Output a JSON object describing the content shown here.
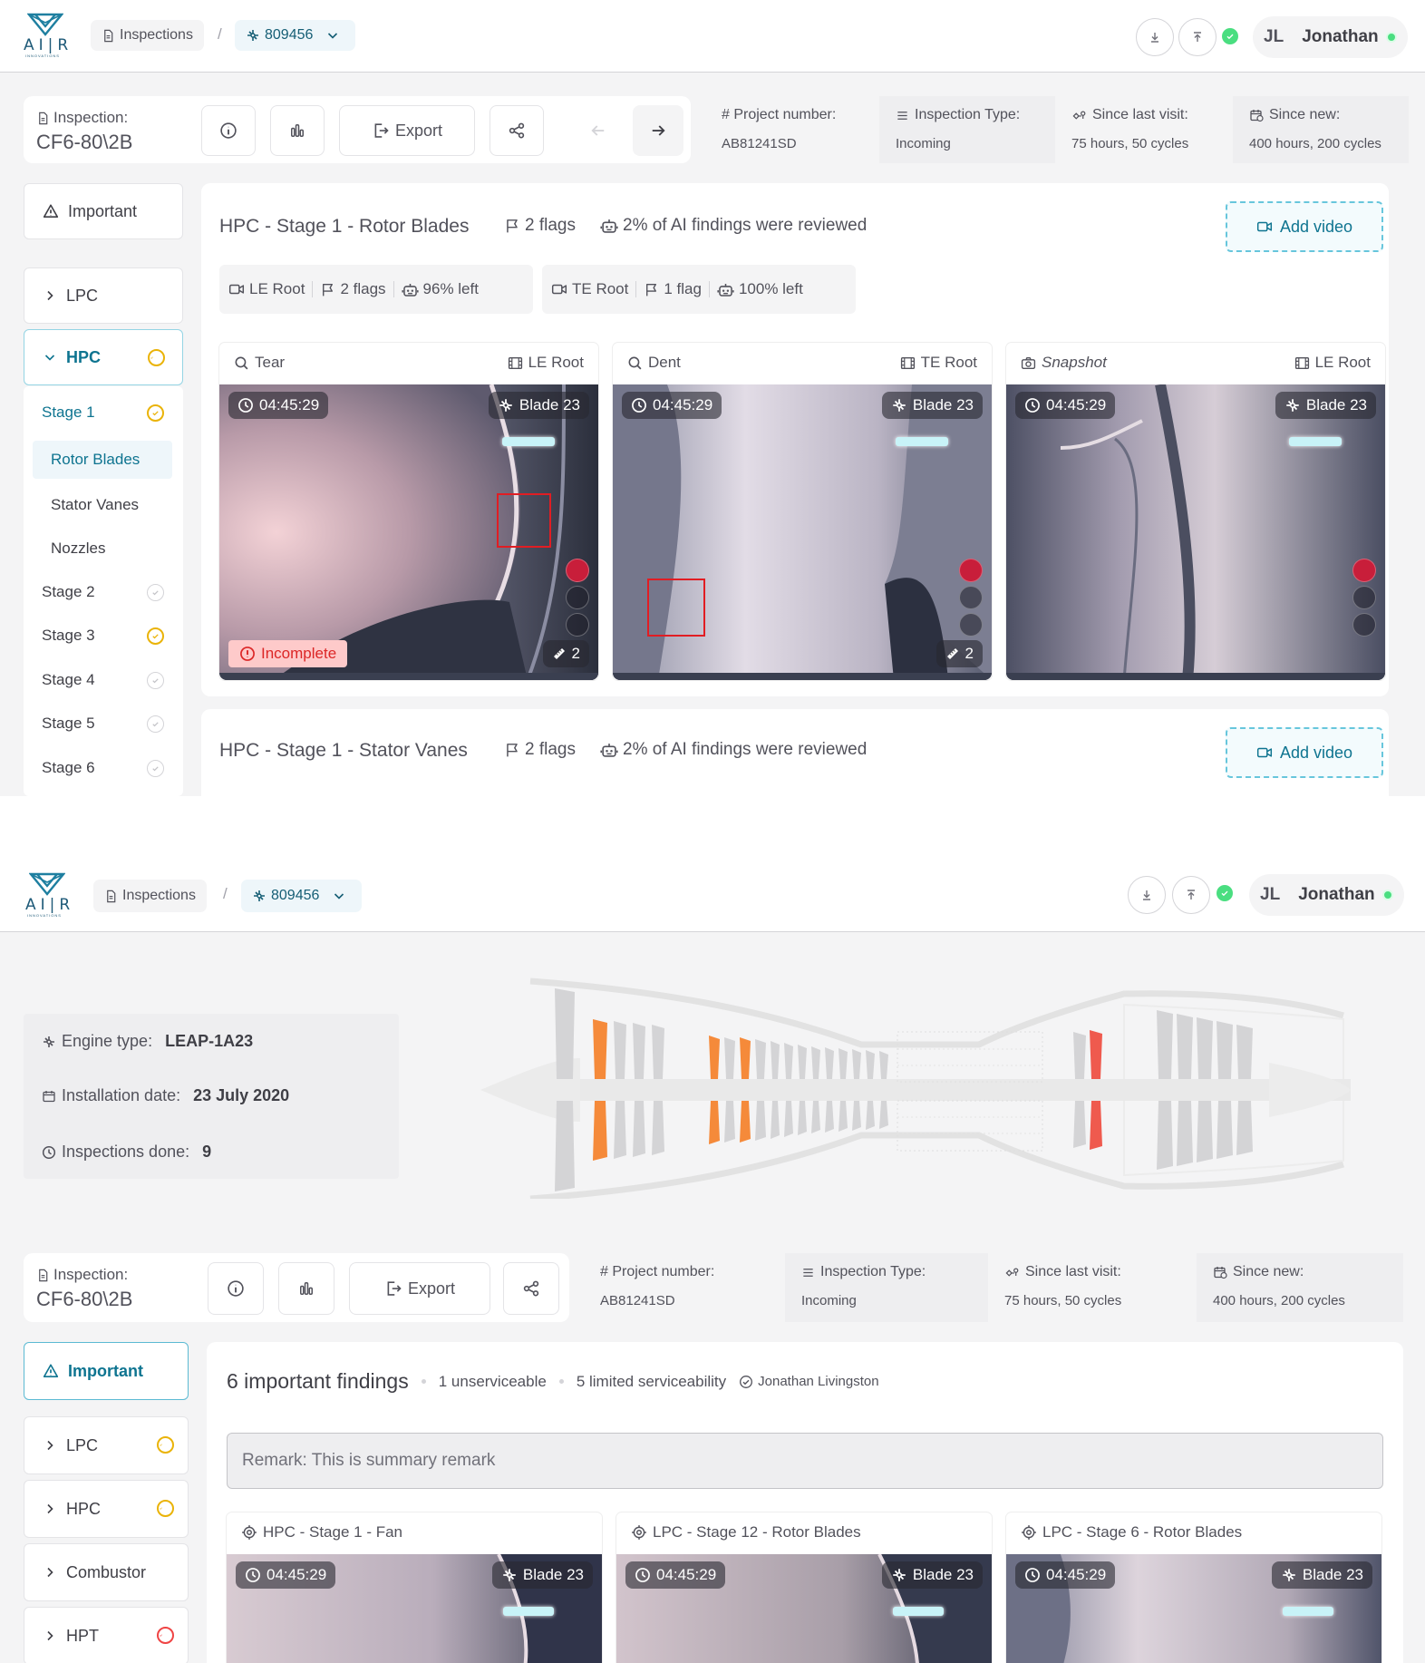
{
  "app": {
    "logo_text": "AI|R",
    "logo_sub": "INNOVATIONS"
  },
  "breadcrumb": {
    "inspections": "Inspections",
    "serial": "809456"
  },
  "user": {
    "initials": "JL",
    "name": "Jonathan"
  },
  "inspection": {
    "label": "Inspection:",
    "value": "CF6-80\\2B"
  },
  "toolbar": {
    "export": "Export"
  },
  "info": {
    "project_label": "# Project number:",
    "project_value": "AB81241SD",
    "type_label": "Inspection Type:",
    "type_value": "Incoming",
    "since_visit_label": "Since last visit:",
    "since_visit_value": "75 hours, 50 cycles",
    "since_new_label": "Since new:",
    "since_new_value": "400 hours, 200 cycles"
  },
  "sidebar1": {
    "important": "Important",
    "lpc": "LPC",
    "hpc": "HPC",
    "stage1": "Stage 1",
    "rotor": "Rotor Blades",
    "stator": "Stator Vanes",
    "nozzles": "Nozzles",
    "stage2": "Stage 2",
    "stage3": "Stage 3",
    "stage4": "Stage 4",
    "stage5": "Stage 5",
    "stage6": "Stage 6"
  },
  "section1": {
    "title": "HPC - Stage 1 - Rotor Blades",
    "flags": "2 flags",
    "reviewed": "2% of AI findings were reviewed",
    "add_video": "Add video",
    "le_label": "LE Root",
    "le_flags": "2 flags",
    "le_left": "96% left",
    "te_label": "TE Root",
    "te_flags": "1 flag",
    "te_left": "100% left"
  },
  "findings": [
    {
      "type": "Tear",
      "location": "LE Root",
      "time": "04:45:29",
      "blade": "Blade 23",
      "status": "Incomplete",
      "count": "2"
    },
    {
      "type": "Dent",
      "location": "TE Root",
      "time": "04:45:29",
      "blade": "Blade 23",
      "count": "2"
    },
    {
      "type": "Snapshot",
      "location": "LE Root",
      "time": "04:45:29",
      "blade": "Blade 23"
    }
  ],
  "section2": {
    "title": "HPC - Stage 1 - Stator Vanes",
    "flags": "2 flags",
    "reviewed": "2% of AI findings were reviewed",
    "add_video": "Add video"
  },
  "engine": {
    "type_label": "Engine type:",
    "type_value": "LEAP-1A23",
    "install_label": "Installation date:",
    "install_value": "23 July 2020",
    "done_label": "Inspections done:",
    "done_value": "9"
  },
  "summary": {
    "title": "6 important findings",
    "unserviceable": "1 unserviceable",
    "limited": "5 limited serviceability",
    "reviewer": "Jonathan Livingston",
    "remark": "Remark: This is summary remark"
  },
  "sidebar2": {
    "important": "Important",
    "lpc": "LPC",
    "hpc": "HPC",
    "combustor": "Combustor",
    "hpt": "HPT"
  },
  "important_findings": [
    {
      "title": "HPC - Stage 1 - Fan",
      "time": "04:45:29",
      "blade": "Blade 23"
    },
    {
      "title": "LPC - Stage 12 - Rotor Blades",
      "time": "04:45:29",
      "blade": "Blade 23"
    },
    {
      "title": "LPC - Stage 6 - Rotor Blades",
      "time": "04:45:29",
      "blade": "Blade 23"
    }
  ],
  "colors": {
    "accent": "#0e7490",
    "warning": "#eab308",
    "danger": "#ef4444",
    "highlight_orange": "#f58a3a",
    "highlight_red": "#ef5a4e"
  }
}
